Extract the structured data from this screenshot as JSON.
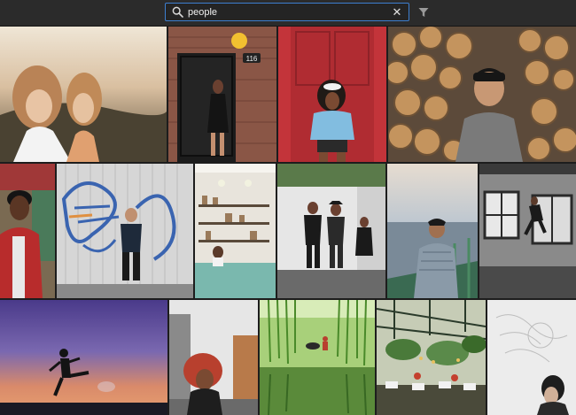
{
  "search": {
    "query": "people"
  },
  "icons": {
    "search": "magnifier-icon",
    "clear": "close-icon",
    "filter": "funnel-icon"
  },
  "photos": [
    {
      "name": "photo-two-women-sunset",
      "colors": [
        "#caa98a",
        "#7a6a5c",
        "#3b3528"
      ]
    },
    {
      "name": "photo-woman-black-door-116",
      "colors": [
        "#8b5a4c",
        "#1a1a1a",
        "#5a3a30"
      ]
    },
    {
      "name": "photo-woman-red-door",
      "colors": [
        "#b8343a",
        "#7ab3d8",
        "#d44545"
      ]
    },
    {
      "name": "photo-man-firewood-pile",
      "colors": [
        "#b58a5c",
        "#5a4a3c",
        "#8a6a4a"
      ]
    },
    {
      "name": "photo-man-red-jacket",
      "colors": [
        "#9a2a2a",
        "#3a3a3a",
        "#c4b08a"
      ]
    },
    {
      "name": "photo-man-graffiti-wall",
      "colors": [
        "#d8d8d8",
        "#3a6ab0",
        "#2a2a2a"
      ]
    },
    {
      "name": "photo-coffee-shop",
      "colors": [
        "#e6e2da",
        "#7ab8b0",
        "#3a3a3a"
      ]
    },
    {
      "name": "photo-group-white-wall",
      "colors": [
        "#e8e8e8",
        "#2a2a2a",
        "#7a7a7a"
      ]
    },
    {
      "name": "photo-man-waterfront",
      "colors": [
        "#c8d4e0",
        "#6a7a8a",
        "#3a5a4a"
      ]
    },
    {
      "name": "photo-man-climbing-window",
      "colors": [
        "#c8c8c8",
        "#4a4a4a",
        "#2a2a2a"
      ]
    },
    {
      "name": "photo-silhouette-dusk",
      "colors": [
        "#7a6ab0",
        "#d88a6a",
        "#1a1a2a"
      ]
    },
    {
      "name": "photo-woman-curly-hair-street",
      "colors": [
        "#e0e0e0",
        "#b84a3a",
        "#2a2a2a"
      ]
    },
    {
      "name": "photo-willow-trees-lake",
      "colors": [
        "#7ab84a",
        "#3a6a2a",
        "#c8e0a0"
      ]
    },
    {
      "name": "photo-greenhouse-restaurant",
      "colors": [
        "#5a7a4a",
        "#c8c8b0",
        "#2a3a2a"
      ]
    },
    {
      "name": "photo-woman-sketch-mono",
      "colors": [
        "#d8d8d8",
        "#f0f0f0",
        "#2a2a2a"
      ]
    }
  ]
}
